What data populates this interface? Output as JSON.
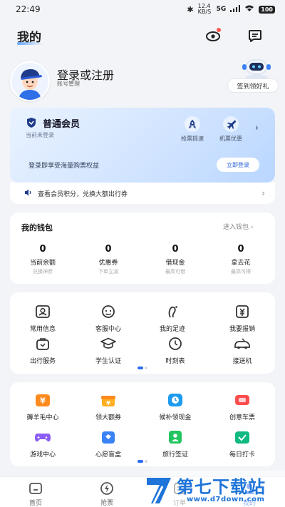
{
  "status": {
    "time": "22:49",
    "speed": "12.4 KB/S",
    "network": "5G",
    "battery": "100"
  },
  "header": {
    "title": "我的"
  },
  "profile": {
    "login": "登录或注册",
    "account": "账号管理",
    "checkin": "签到领好礼"
  },
  "member": {
    "title": "普通会员",
    "subtitle": "当前未登录",
    "perks": [
      {
        "label": "抢票提速"
      },
      {
        "label": "机票优惠"
      }
    ],
    "promo": "登录即享受海量购票权益",
    "login_button": "立即登录",
    "notice": "查看会员积分，兑换大额出行券"
  },
  "wallet": {
    "title": "我的钱包",
    "link": "进入钱包",
    "items": [
      {
        "value": "0",
        "label": "当前余额",
        "sub": "兑换神券"
      },
      {
        "value": "0",
        "label": "优惠券",
        "sub": "下单立减"
      },
      {
        "value": "0",
        "label": "借现金",
        "sub": "最高可借"
      },
      {
        "value": "0",
        "label": "拿去花",
        "sub": "最高可得"
      }
    ]
  },
  "services": {
    "items": [
      {
        "label": "常用信息",
        "icon": "id-card-icon"
      },
      {
        "label": "客服中心",
        "icon": "support-icon"
      },
      {
        "label": "我的足迹",
        "icon": "footprint-icon"
      },
      {
        "label": "我要报销",
        "icon": "reimburse-icon"
      },
      {
        "label": "出行服务",
        "icon": "travel-bag-icon"
      },
      {
        "label": "学生认证",
        "icon": "graduation-cap-icon"
      },
      {
        "label": "时刻表",
        "icon": "clock-icon"
      },
      {
        "label": "接送机",
        "icon": "airport-car-icon"
      }
    ]
  },
  "apps": {
    "items": [
      {
        "label": "薅羊毛中心",
        "icon": "coin-box-icon",
        "color": "#ff8a1f"
      },
      {
        "label": "领大额券",
        "icon": "gift-icon",
        "color": "#ffb020"
      },
      {
        "label": "候补领现金",
        "icon": "cash-icon",
        "color": "#1d9bf0"
      },
      {
        "label": "创意车票",
        "icon": "ticket-icon",
        "color": "#ff4d4f"
      },
      {
        "label": "游戏中心",
        "icon": "gamepad-icon",
        "color": "#8b5cf6"
      },
      {
        "label": "心愿盲盒",
        "icon": "blind-box-icon",
        "color": "#3b82f6"
      },
      {
        "label": "旅行签证",
        "icon": "visa-icon",
        "color": "#22c55e"
      },
      {
        "label": "每日打卡",
        "icon": "check-in-icon",
        "color": "#10b981"
      }
    ]
  },
  "tabbar": {
    "items": [
      {
        "label": "首页"
      },
      {
        "label": "抢票"
      },
      {
        "label": "订单"
      },
      {
        "label": "我的"
      }
    ]
  },
  "watermark": {
    "title": "第七下载站",
    "url": "www.d7down.com"
  }
}
